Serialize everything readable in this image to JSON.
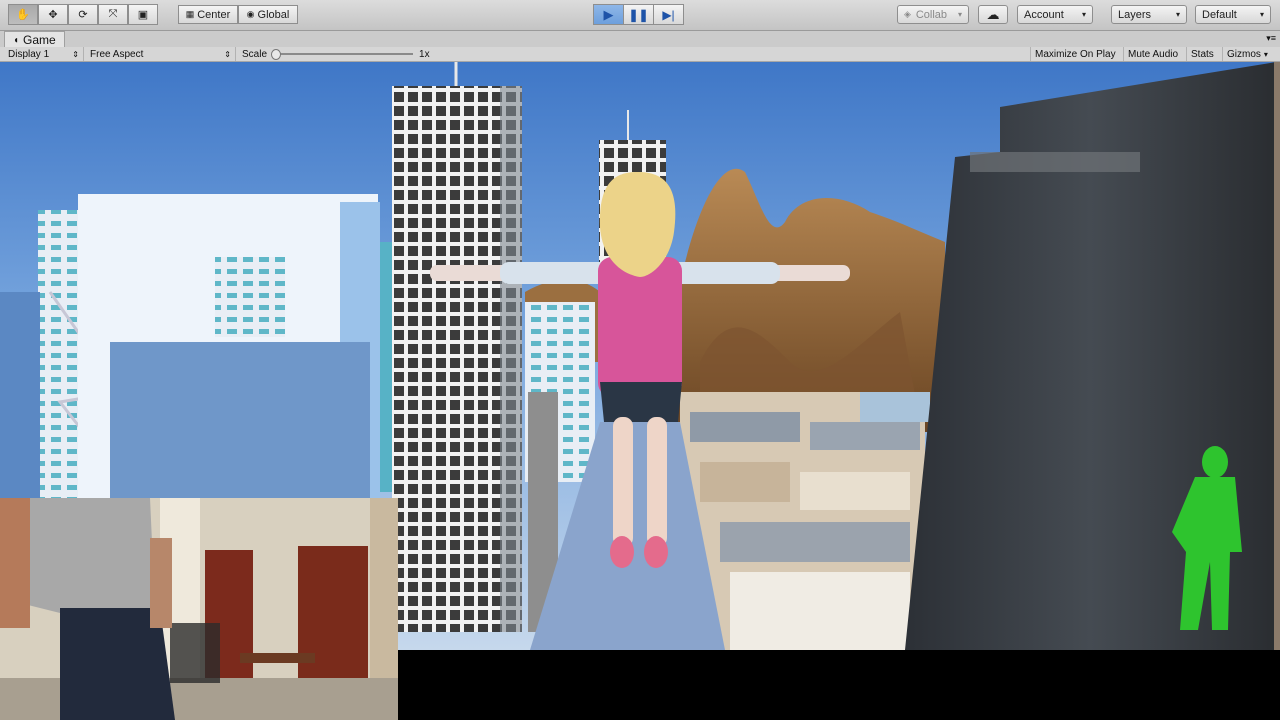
{
  "toolbar": {
    "tools": [
      {
        "name": "hand-tool-icon",
        "glyph": "✋"
      },
      {
        "name": "move-tool-icon",
        "glyph": "✥"
      },
      {
        "name": "rotate-tool-icon",
        "glyph": "⟳"
      },
      {
        "name": "scale-tool-icon",
        "glyph": "⤧"
      },
      {
        "name": "rect-tool-icon",
        "glyph": "▣"
      }
    ],
    "pivot_label": "Center",
    "space_label": "Global",
    "collab_label": "Collab",
    "account_label": "Account",
    "layers_label": "Layers",
    "layout_label": "Default"
  },
  "game_tab": {
    "label": "Game",
    "display": "Display 1",
    "aspect": "Free Aspect",
    "scale_label": "Scale",
    "scale_value": "1x",
    "maximize_label": "Maximize On Play",
    "mute_label": "Mute Audio",
    "stats_label": "Stats",
    "gizmos_label": "Gizmos"
  },
  "colors": {
    "play_active": "#6d9fdc",
    "sky_top": "#3f77c7",
    "character_shirt": "#d7559a",
    "avatar_green": "#2ec42e",
    "mountain": "#a8743f"
  }
}
